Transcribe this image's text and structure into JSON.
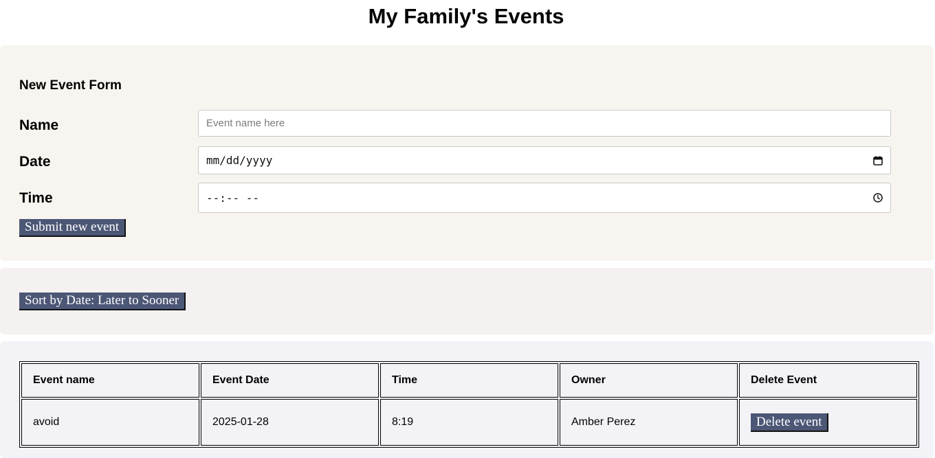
{
  "page": {
    "title": "My Family's Events"
  },
  "form": {
    "heading": "New Event Form",
    "name_label": "Name",
    "name_placeholder": "Event name here",
    "date_label": "Date",
    "date_value": "mm/dd/yyyy",
    "time_label": "Time",
    "time_value": "--:-- --",
    "submit_label": "Submit new event",
    "date_icon": "calendar-icon",
    "time_icon": "clock-icon"
  },
  "sort": {
    "label": "Sort by Date: Later to Sooner"
  },
  "table": {
    "headers": [
      "Event name",
      "Event Date",
      "Time",
      "Owner",
      "Delete Event"
    ],
    "rows": [
      {
        "name": "avoid",
        "date": "2025-01-28",
        "time": "8:19",
        "owner": "Amber Perez",
        "delete_label": "Delete event"
      }
    ]
  },
  "colors": {
    "button_bg": "#4c5776",
    "form_panel_bg": "#f8f5f0",
    "sort_panel_bg": "#f5f1f1",
    "table_panel_bg": "#f3f2f7"
  }
}
